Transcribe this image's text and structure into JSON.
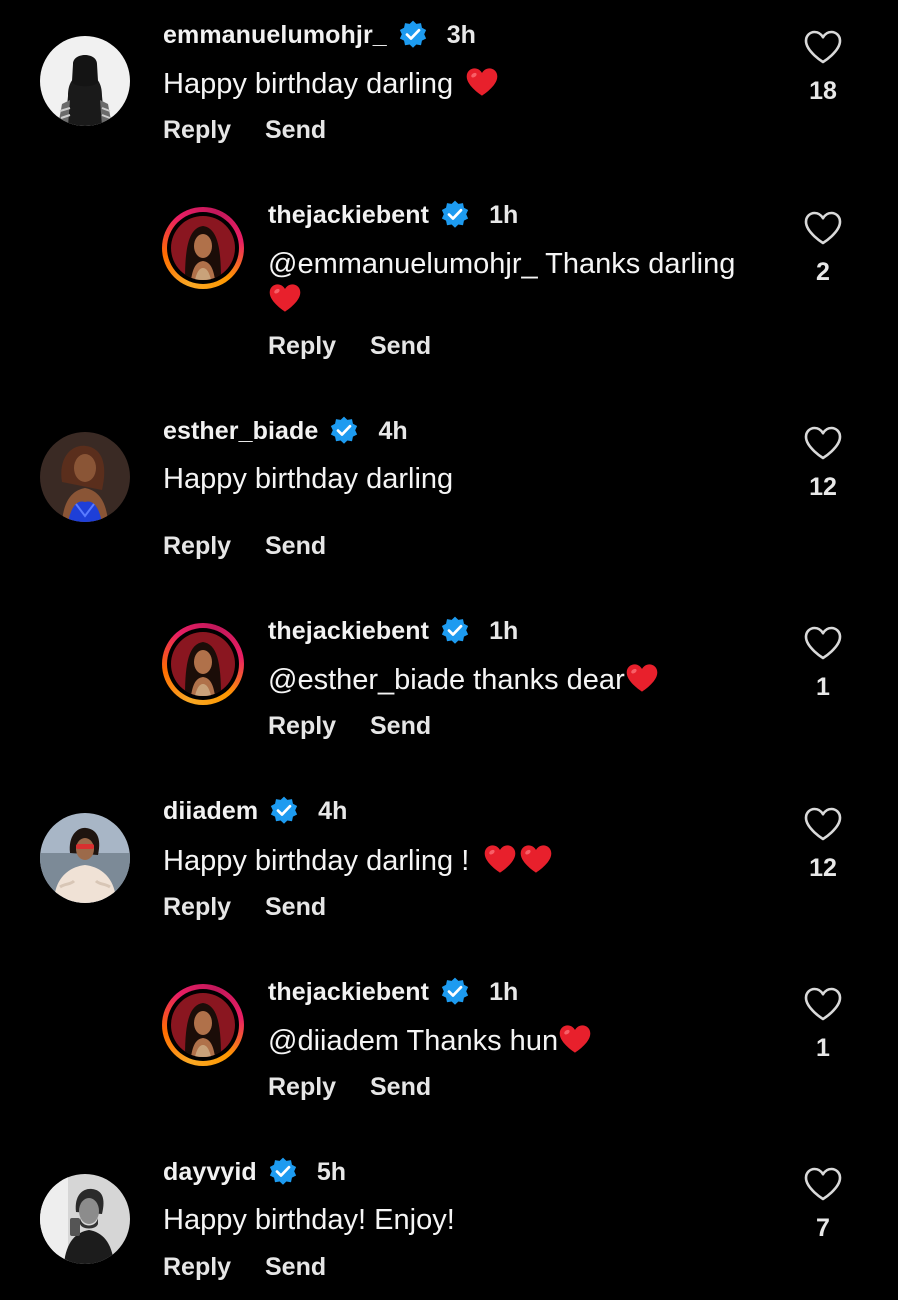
{
  "comments": [
    {
      "username": "emmanuelumohjr_",
      "verified": true,
      "time": "3h",
      "text": "Happy birthday darling",
      "emoji": "red-heart",
      "likes": "18",
      "reply_label": "Reply",
      "send_label": "Send",
      "avatar": "hooded-figure-avatar"
    },
    {
      "username": "thejackiebent",
      "verified": true,
      "time": "1h",
      "text": "@emmanuelumohjr_ Thanks darling",
      "emoji": "red-heart",
      "likes": "2",
      "reply_label": "Reply",
      "send_label": "Send",
      "avatar": "woman-story-ring-avatar"
    },
    {
      "username": "esther_biade",
      "verified": true,
      "time": "4h",
      "text": "Happy birthday darling",
      "likes": "12",
      "reply_label": "Reply",
      "send_label": "Send",
      "avatar": "woman-blue-dress-avatar"
    },
    {
      "username": "thejackiebent",
      "verified": true,
      "time": "1h",
      "text": "@esther_biade thanks dear",
      "emoji": "red-heart",
      "likes": "1",
      "reply_label": "Reply",
      "send_label": "Send",
      "avatar": "woman-story-ring-avatar"
    },
    {
      "username": "diiadem",
      "verified": true,
      "time": "4h",
      "text": "Happy birthday darling !",
      "emoji": "two-red-hearts",
      "likes": "12",
      "reply_label": "Reply",
      "send_label": "Send",
      "avatar": "woman-fur-coat-avatar"
    },
    {
      "username": "thejackiebent",
      "verified": true,
      "time": "1h",
      "text": "@diiadem Thanks hun",
      "emoji": "red-heart",
      "likes": "1",
      "reply_label": "Reply",
      "send_label": "Send",
      "avatar": "woman-story-ring-avatar"
    },
    {
      "username": "dayvyid",
      "verified": true,
      "time": "5h",
      "text": "Happy birthday! Enjoy!",
      "likes": "7",
      "reply_label": "Reply",
      "send_label": "Send",
      "avatar": "man-mirror-selfie-avatar"
    }
  ],
  "colors": {
    "background": "#000000",
    "verified_badge": "#1d9bf0",
    "heart_emoji": "#e8202c",
    "text": "#f5f5f5"
  }
}
